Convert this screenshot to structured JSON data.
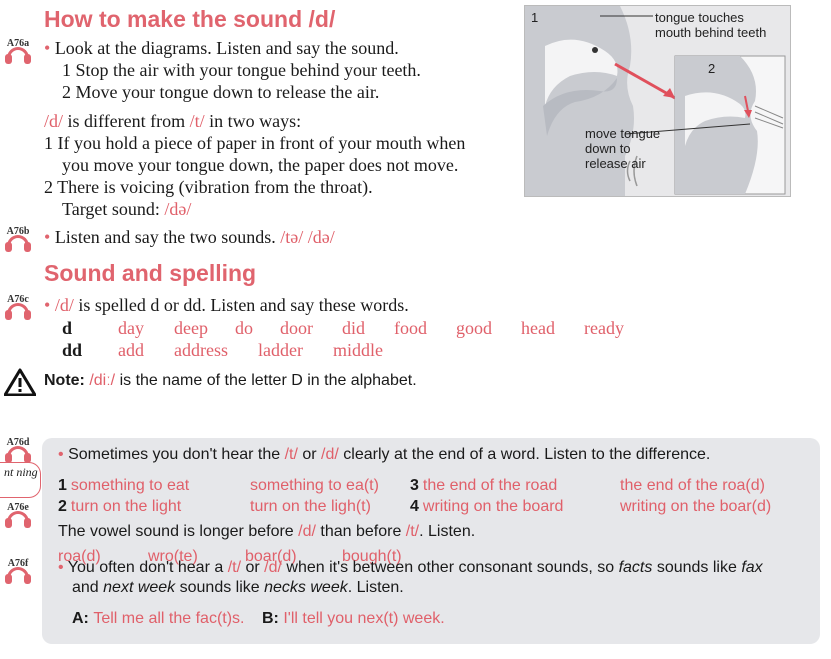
{
  "section1": {
    "title": "How to make the sound /d/",
    "audio_a": "A76a",
    "bullet1": "Look at the diagrams. Listen and say the sound.",
    "step1": "1 Stop the air with your tongue behind your teeth.",
    "step2": "2 Move your tongue down to release the air.",
    "diff_intro_d": "/d/",
    "diff_intro_mid": " is different from ",
    "diff_intro_t": "/t/",
    "diff_intro_end": " in two ways:",
    "diff1a": "1 If you hold a piece of paper in front of your mouth when",
    "diff1b": "you move your tongue down, the paper does not move.",
    "diff2": "2 There is voicing (vibration from the throat).",
    "target_label": "Target sound: ",
    "target_sound": "/də/",
    "audio_b": "A76b",
    "bullet2": "Listen and say the two sounds. ",
    "pair_t": "/tə/",
    "pair_d": "/də/"
  },
  "diagram": {
    "num1": "1",
    "num2": "2",
    "label1a": "tongue touches",
    "label1b": "mouth behind teeth",
    "label2a": "move tongue",
    "label2b": "down to",
    "label2c": "release air"
  },
  "section2": {
    "title": "Sound and spelling",
    "audio_c": "A76c",
    "spell_d": "/d/",
    "spell_text": " is spelled d or dd. Listen and say these words.",
    "row1_head": "d",
    "row1_words": [
      "day",
      "deep",
      "do",
      "door",
      "did",
      "food",
      "good",
      "head",
      "ready"
    ],
    "row2_head": "dd",
    "row2_words": [
      "add",
      "address",
      "ladder",
      "middle"
    ],
    "note_label": "Note: ",
    "note_sound": "/diː/",
    "note_text": " is the name of the letter D in the alphabet."
  },
  "box": {
    "audio_d": "A76d",
    "side_note": "nt ning",
    "intro_a": "Sometimes you don't hear the ",
    "intro_t": "/t/",
    "intro_or": " or ",
    "intro_d": "/d/",
    "intro_b": " clearly at the end of a word. Listen to the difference.",
    "pairs": [
      {
        "num": "1",
        "a": "something to eat",
        "b": "something to ea(t)"
      },
      {
        "num": "2",
        "a": "turn on the light",
        "b": "turn on the ligh(t)"
      },
      {
        "num": "3",
        "a": "the end of the road",
        "b": "the end of the roa(d)"
      },
      {
        "num": "4",
        "a": "writing on the board",
        "b": "writing on the boar(d)"
      }
    ],
    "audio_e": "A76e",
    "vowel_a": "The vowel sound is longer before ",
    "vowel_d": "/d/",
    "vowel_mid": " than before ",
    "vowel_t": "/t/",
    "vowel_end": ". Listen.",
    "vowel_words": [
      "roa(d)",
      "wro(te)",
      "boar(d)",
      "bough(t)"
    ],
    "audio_f": "A76f",
    "cons_a": "You often don't hear a ",
    "cons_t": "/t/",
    "cons_or": " or ",
    "cons_d": "/d/",
    "cons_b": " when it's between other consonant sounds, so ",
    "cons_facts": "facts",
    "cons_c": " sounds like ",
    "cons_fax": "fax",
    "cons2_a": "and ",
    "cons2_next": "next week",
    "cons2_b": " sounds like ",
    "cons2_necks": "necks week",
    "cons2_c": ". Listen.",
    "dialog_a_label": "A: ",
    "dialog_a": "Tell me all the fac(t)s.",
    "dialog_b_label": "B: ",
    "dialog_b": "I'll tell you nex(t) week."
  },
  "colors": {
    "accent": "#e0646e",
    "box": "#e6e7ea"
  }
}
